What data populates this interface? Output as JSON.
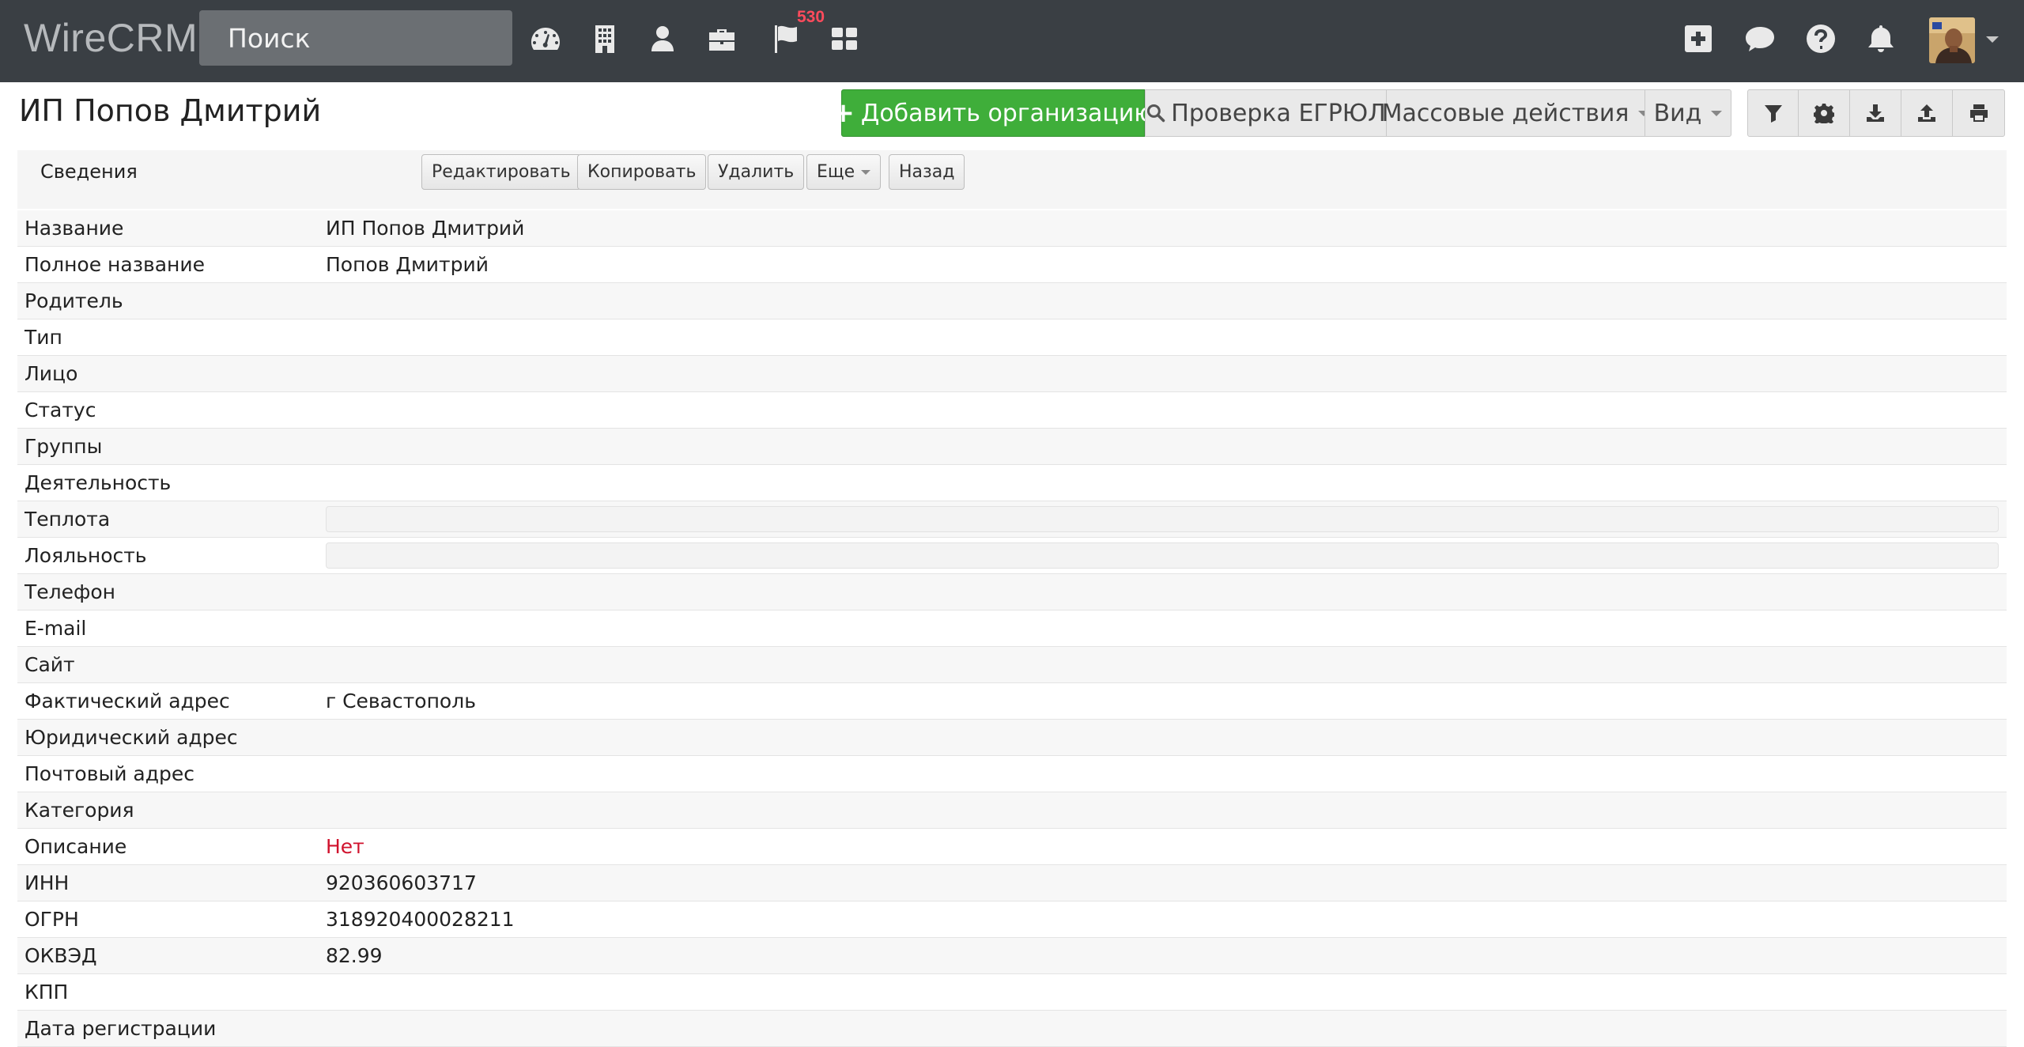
{
  "navbar": {
    "brand": "WireCRM",
    "search_placeholder": "Поиск",
    "icons": [
      "dashboard-icon",
      "building-icon",
      "user-icon",
      "briefcase-icon",
      "flag-icon",
      "grid-icon"
    ],
    "flag_badge": "530",
    "right_icons": [
      "plus-square-icon",
      "chat-icon",
      "help-icon",
      "bell-icon"
    ]
  },
  "page": {
    "title": "ИП Попов Дмитрий"
  },
  "toolbar": {
    "add_org": "Добавить организацию",
    "check_egrul": "Проверка ЕГРЮЛ",
    "mass_actions": "Массовые действия",
    "view": "Вид"
  },
  "colors": {
    "navbar": "#3a3f44",
    "primary_green": "#3fae3a",
    "badge_red": "#ff4b5c",
    "value_red": "#d0122d"
  },
  "subbar": {
    "tab_info": "Сведения",
    "edit": "Редактировать",
    "copy": "Копировать",
    "delete": "Удалить",
    "more": "Еще",
    "back": "Назад"
  },
  "details": {
    "rows": [
      {
        "label": "Название",
        "value": "ИП Попов Дмитрий"
      },
      {
        "label": "Полное название",
        "value": "Попов Дмитрий"
      },
      {
        "label": "Родитель",
        "value": ""
      },
      {
        "label": "Тип",
        "value": ""
      },
      {
        "label": "Лицо",
        "value": ""
      },
      {
        "label": "Статус",
        "value": ""
      },
      {
        "label": "Группы",
        "value": ""
      },
      {
        "label": "Деятельность",
        "value": ""
      },
      {
        "label": "Теплота",
        "value": ""
      },
      {
        "label": "Лояльность",
        "value": ""
      },
      {
        "label": "Телефон",
        "value": ""
      },
      {
        "label": "E-mail",
        "value": ""
      },
      {
        "label": "Сайт",
        "value": ""
      },
      {
        "label": "Фактический адрес",
        "value": "г Севастополь"
      },
      {
        "label": "Юридический адрес",
        "value": ""
      },
      {
        "label": "Почтовый адрес",
        "value": ""
      },
      {
        "label": "Категория",
        "value": ""
      },
      {
        "label": "Описание",
        "value": "Нет"
      },
      {
        "label": "ИНН",
        "value": "920360603717"
      },
      {
        "label": "ОГРН",
        "value": "318920400028211"
      },
      {
        "label": "ОКВЭД",
        "value": "82.99"
      },
      {
        "label": "КПП",
        "value": ""
      },
      {
        "label": "Дата регистрации",
        "value": ""
      }
    ]
  }
}
